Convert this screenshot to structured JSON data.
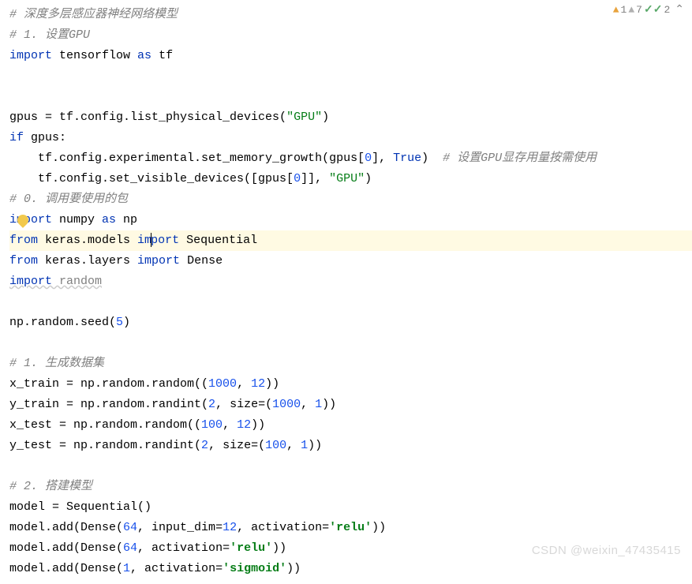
{
  "badges": {
    "warn1_count": "1",
    "warn2_count": "7",
    "check_count": "2"
  },
  "watermark": "CSDN @weixin_47435415",
  "lines": [
    {
      "segs": [
        {
          "t": "comment",
          "v": "# 深度多层感应器神经网络模型"
        }
      ]
    },
    {
      "segs": [
        {
          "t": "comment",
          "v": "# 1. 设置GPU"
        }
      ]
    },
    {
      "segs": [
        {
          "t": "keyword",
          "v": "import"
        },
        {
          "t": "plain",
          "v": " tensorflow "
        },
        {
          "t": "keyword",
          "v": "as"
        },
        {
          "t": "plain",
          "v": " tf"
        }
      ]
    },
    {
      "segs": []
    },
    {
      "segs": []
    },
    {
      "segs": [
        {
          "t": "plain",
          "v": "gpus = tf.config.list_physical_devices("
        },
        {
          "t": "string",
          "v": "\"GPU\""
        },
        {
          "t": "plain",
          "v": ")"
        }
      ]
    },
    {
      "segs": [
        {
          "t": "keyword",
          "v": "if"
        },
        {
          "t": "plain",
          "v": " gpus:"
        }
      ]
    },
    {
      "segs": [
        {
          "t": "plain",
          "v": "    tf.config.experimental.set_memory_growth(gpus["
        },
        {
          "t": "number",
          "v": "0"
        },
        {
          "t": "plain",
          "v": "], "
        },
        {
          "t": "bool",
          "v": "True"
        },
        {
          "t": "plain",
          "v": ")  "
        },
        {
          "t": "comment",
          "v": "# 设置GPU显存用量按需使用"
        }
      ]
    },
    {
      "segs": [
        {
          "t": "plain",
          "v": "    tf.config.set_visible_devices([gpus["
        },
        {
          "t": "number",
          "v": "0"
        },
        {
          "t": "plain",
          "v": "]], "
        },
        {
          "t": "string",
          "v": "\"GPU\""
        },
        {
          "t": "plain",
          "v": ")"
        }
      ]
    },
    {
      "segs": [
        {
          "t": "comment",
          "v": "# 0. 调用要使用的包"
        }
      ]
    },
    {
      "bulb": true,
      "segs": [
        {
          "t": "keyword",
          "v": "import"
        },
        {
          "t": "plain",
          "v": " numpy "
        },
        {
          "t": "keyword",
          "v": "as"
        },
        {
          "t": "plain",
          "v": " np"
        }
      ]
    },
    {
      "hl": true,
      "caret_after_idx": 3,
      "segs": [
        {
          "t": "keyword",
          "v": "from"
        },
        {
          "t": "plain",
          "v": " keras.models "
        },
        {
          "t": "keyword",
          "v": "im"
        },
        {
          "t": "keyword",
          "v": "port"
        },
        {
          "t": "plain",
          "v": " Sequential"
        }
      ]
    },
    {
      "segs": [
        {
          "t": "keyword",
          "v": "from"
        },
        {
          "t": "plain",
          "v": " keras.layers "
        },
        {
          "t": "keyword",
          "v": "import"
        },
        {
          "t": "plain",
          "v": " Dense"
        }
      ]
    },
    {
      "wavy": true,
      "segs": [
        {
          "t": "keyword",
          "v": "import"
        },
        {
          "t": "plain",
          "v": " random"
        }
      ]
    },
    {
      "segs": []
    },
    {
      "segs": [
        {
          "t": "plain",
          "v": "np.random.seed("
        },
        {
          "t": "number",
          "v": "5"
        },
        {
          "t": "plain",
          "v": ")"
        }
      ]
    },
    {
      "segs": []
    },
    {
      "segs": [
        {
          "t": "comment",
          "v": "# 1. 生成数据集"
        }
      ]
    },
    {
      "segs": [
        {
          "t": "plain",
          "v": "x_train = np.random.random(("
        },
        {
          "t": "number",
          "v": "1000"
        },
        {
          "t": "plain",
          "v": ", "
        },
        {
          "t": "number",
          "v": "12"
        },
        {
          "t": "plain",
          "v": "))"
        }
      ]
    },
    {
      "segs": [
        {
          "t": "plain",
          "v": "y_train = np.random.randint("
        },
        {
          "t": "number",
          "v": "2"
        },
        {
          "t": "plain",
          "v": ", size=("
        },
        {
          "t": "number",
          "v": "1000"
        },
        {
          "t": "plain",
          "v": ", "
        },
        {
          "t": "number",
          "v": "1"
        },
        {
          "t": "plain",
          "v": "))"
        }
      ]
    },
    {
      "segs": [
        {
          "t": "plain",
          "v": "x_test = np.random.random(("
        },
        {
          "t": "number",
          "v": "100"
        },
        {
          "t": "plain",
          "v": ", "
        },
        {
          "t": "number",
          "v": "12"
        },
        {
          "t": "plain",
          "v": "))"
        }
      ]
    },
    {
      "segs": [
        {
          "t": "plain",
          "v": "y_test = np.random.randint("
        },
        {
          "t": "number",
          "v": "2"
        },
        {
          "t": "plain",
          "v": ", size=("
        },
        {
          "t": "number",
          "v": "100"
        },
        {
          "t": "plain",
          "v": ", "
        },
        {
          "t": "number",
          "v": "1"
        },
        {
          "t": "plain",
          "v": "))"
        }
      ]
    },
    {
      "segs": []
    },
    {
      "segs": [
        {
          "t": "comment",
          "v": "# 2. 搭建模型"
        }
      ]
    },
    {
      "segs": [
        {
          "t": "plain",
          "v": "model = Sequential()"
        }
      ]
    },
    {
      "segs": [
        {
          "t": "plain",
          "v": "model.add(Dense("
        },
        {
          "t": "number",
          "v": "64"
        },
        {
          "t": "plain",
          "v": ", input_dim="
        },
        {
          "t": "number",
          "v": "12"
        },
        {
          "t": "plain",
          "v": ", activation="
        },
        {
          "t": "stringb",
          "v": "'relu'"
        },
        {
          "t": "plain",
          "v": "))"
        }
      ]
    },
    {
      "segs": [
        {
          "t": "plain",
          "v": "model.add(Dense("
        },
        {
          "t": "number",
          "v": "64"
        },
        {
          "t": "plain",
          "v": ", activation="
        },
        {
          "t": "stringb",
          "v": "'relu'"
        },
        {
          "t": "plain",
          "v": "))"
        }
      ]
    },
    {
      "segs": [
        {
          "t": "plain",
          "v": "model.add(Dense("
        },
        {
          "t": "number",
          "v": "1"
        },
        {
          "t": "plain",
          "v": ", activation="
        },
        {
          "t": "stringb",
          "v": "'sigmoid'"
        },
        {
          "t": "plain",
          "v": "))"
        }
      ]
    }
  ]
}
